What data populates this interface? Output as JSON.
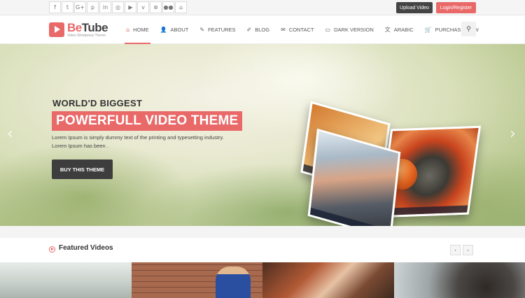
{
  "topbar": {
    "social": [
      {
        "icon": "facebook-icon",
        "glyph": "f"
      },
      {
        "icon": "twitter-icon",
        "glyph": "t"
      },
      {
        "icon": "google-plus-icon",
        "glyph": "G+"
      },
      {
        "icon": "pinterest-icon",
        "glyph": "p"
      },
      {
        "icon": "linkedin-icon",
        "glyph": "in"
      },
      {
        "icon": "instagram-icon",
        "glyph": "◎"
      },
      {
        "icon": "youtube-icon",
        "glyph": "▶"
      },
      {
        "icon": "vimeo-icon",
        "glyph": "v"
      },
      {
        "icon": "dribbble-icon",
        "glyph": "⊛"
      },
      {
        "icon": "flickr-icon",
        "glyph": "●●"
      },
      {
        "icon": "github-icon",
        "glyph": "⌂"
      }
    ],
    "upload_label": "Upload Video",
    "login_label": "Login/Register"
  },
  "header": {
    "logo_name_a": "Be",
    "logo_name_b": "Tube",
    "logo_tagline": "Video Wordpress Theme",
    "nav": [
      {
        "label": "Home",
        "icon": "home-icon",
        "glyph": "⌂",
        "active": true
      },
      {
        "label": "About",
        "icon": "user-icon",
        "glyph": "👤"
      },
      {
        "label": "Features",
        "icon": "wrench-icon",
        "glyph": "✎"
      },
      {
        "label": "Blog",
        "icon": "edit-icon",
        "glyph": "✐"
      },
      {
        "label": "Contact",
        "icon": "envelope-icon",
        "glyph": "✉"
      },
      {
        "label": "Dark Version",
        "icon": "monitor-icon",
        "glyph": "▭"
      },
      {
        "label": "Arabic",
        "icon": "translate-icon",
        "glyph": "文"
      },
      {
        "label": "Purchase Now",
        "icon": "cart-icon",
        "glyph": "🛒"
      }
    ],
    "search_icon": "search-icon"
  },
  "hero": {
    "kicker": "WORLD'D BIGGEST",
    "headline": "POWERFULL VIDEO THEME",
    "description": "Lorem Ipsum is simply dummy text of the printing and typesetting industry. Lorem Ipsum has been .",
    "cta_label": "BUY THIS THEME",
    "prev_glyph": "‹",
    "next_glyph": "›"
  },
  "featured": {
    "title": "Featured Videos",
    "prev_glyph": "‹",
    "next_glyph": "›"
  }
}
